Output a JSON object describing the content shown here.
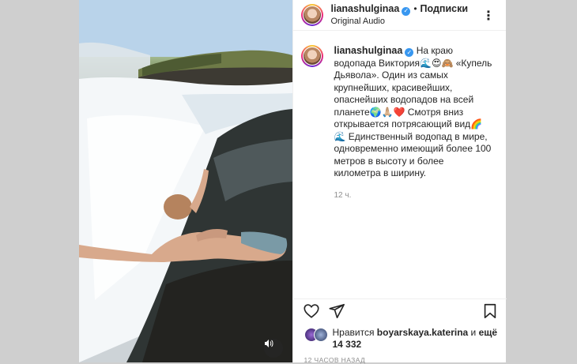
{
  "header": {
    "username": "lianashulginaa",
    "follow_label": "Подписки",
    "separator": "•",
    "audio": "Original Audio",
    "more": "⋮"
  },
  "caption": {
    "username": "lianashulginaa",
    "text": "На краю водопада Виктория🌊😍🙈 «Купель Дьявола». Один из самых крупнейших, красивейших, опаснейших водопадов на всей планете🌍🙏🏼❤️ Смотря вниз открывается потрясающий вид🌈🌊 Единственный водопад в мире, одновременно имеющий более 100 метров в высоту и более километра в ширину.",
    "time": "12 ч."
  },
  "likes": {
    "prefix": "Нравится",
    "liker": "boyarskaya.katerina",
    "middle": "и",
    "count": "ещё 14 332"
  },
  "date": "12 ЧАСОВ НАЗАД",
  "icons": {
    "like": "heart-icon",
    "share": "send-icon",
    "save": "bookmark-icon",
    "sound": "speaker-icon"
  },
  "colors": {
    "verified": "#3897f0",
    "text": "#262626",
    "muted": "#8e8e8e"
  }
}
